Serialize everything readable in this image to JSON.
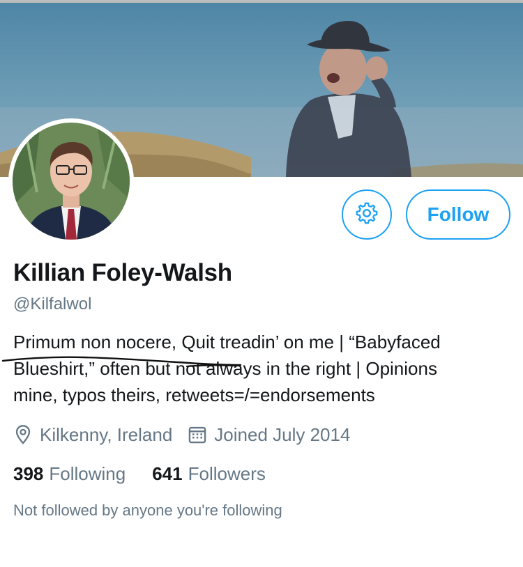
{
  "profile": {
    "name": "Killian Foley-Walsh",
    "handle": "@Kilfalwol",
    "bio_lines": [
      "Primum non nocere, Quit treadin’ on me | “Babyfaced",
      "Blueshirt,” often but not always in the right | Opinions",
      "mine, typos theirs, retweets=/=endorsements"
    ],
    "location": "Kilkenny, Ireland",
    "joined": "Joined July 2014",
    "following_count": "398",
    "following_label": "Following",
    "followers_count": "641",
    "followers_label": "Followers",
    "not_followed_text": "Not followed by anyone you're following"
  },
  "actions": {
    "follow_label": "Follow",
    "settings_icon": "gear-icon"
  },
  "icons": {
    "location": "map-pin-icon",
    "joined": "calendar-icon"
  },
  "colors": {
    "accent": "#1da1f2",
    "primary_text": "#14171a",
    "secondary_text": "#657786"
  }
}
